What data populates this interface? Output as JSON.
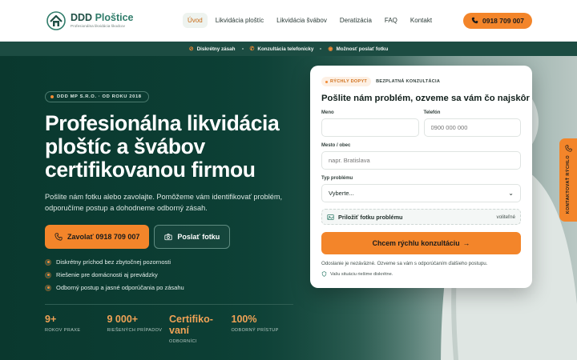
{
  "brand": {
    "name_a": "DDD ",
    "name_b": "Ploštice",
    "tagline": "Profesionálna likvidácia škodcov"
  },
  "nav": {
    "items": [
      "Úvod",
      "Likvidácia ploštíc",
      "Likvidácia švábov",
      "Deratizácia",
      "FAQ",
      "Kontakt"
    ],
    "active": "Úvod",
    "call_label": "0918 709 007"
  },
  "features": [
    "Diskrétny zásah",
    "Konzultácia telefonicky",
    "Možnosť poslať fotku"
  ],
  "hero": {
    "badge": "DDD MP S.R.O. · OD ROKU 2018",
    "title": "Profesionálna likvidácia ploštíc a švábov certifikovanou firmou",
    "lead": "Pošlite nám fotku alebo zavolajte. Pomôžeme vám identifikovať problém, odporučíme postup a dohodneme odborný zásah.",
    "btn_call": "Zavolať 0918 709 007",
    "btn_photo": "Poslať fotku",
    "checks": [
      "Diskrétny príchod bez zbytočnej pozornosti",
      "Riešenie pre domácnosti aj prevádzky",
      "Odborný postup a jasné odporúčania po zásahu"
    ],
    "stats": [
      {
        "num": "9+",
        "label": "ROKOV PRAXE"
      },
      {
        "num": "9 000+",
        "label": "RIEŠENÝCH PRÍPADOV"
      },
      {
        "num": "Certifiko-\nvaní",
        "label": "ODBORNÍCI"
      },
      {
        "num": "100%",
        "label": "ODBORNÝ PRÍSTUP"
      }
    ]
  },
  "form": {
    "pill": "RÝCHLY DOPYT",
    "pill_sub": "BEZPLATNÁ KONZULTÁCIA",
    "title": "Pošlite nám problém, ozveme sa vám čo najskôr",
    "name_label": "Meno",
    "name_placeholder": "",
    "phone_label": "Telefón",
    "phone_placeholder": "0900 000 000",
    "city_label": "Mesto / obec",
    "city_placeholder": "napr. Bratislava",
    "type_label": "Typ problému",
    "type_value": "Vyberte...",
    "upload_label": "Priložiť fotku problému",
    "upload_optional": "voliteľné",
    "submit": "Chcem rýchlu konzultáciu",
    "submit_arrow": "→",
    "note": "Odoslanie je nezáväzné. Ozveme sa vám s odporúčaním ďalšieho postupu.",
    "safe": "Vašu situáciu riešime diskrétne."
  },
  "side_tab": {
    "label": "KONTAKTOVAŤ RÝCHLO"
  },
  "colors": {
    "accent": "#f3852a",
    "dark_green": "#0f4a3e",
    "brand_green": "#2f7c6a"
  }
}
